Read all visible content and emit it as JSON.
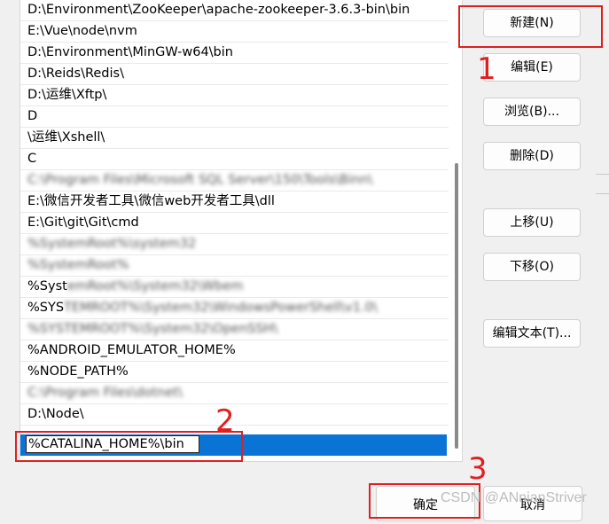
{
  "path_list": {
    "entries": [
      {
        "text": "D:\\Environment\\ZooKeeper\\apache-zookeeper-3.6.3-bin\\bin",
        "blurred": false
      },
      {
        "text": "E:\\Vue\\node\\nvm",
        "blurred": false
      },
      {
        "text": "D:\\Environment\\MinGW-w64\\bin",
        "blurred": false
      },
      {
        "text": "D:\\Reids\\Redis\\",
        "blurred": false
      },
      {
        "text": "D:\\运维\\Xftp\\",
        "blurred": false
      },
      {
        "text": "D",
        "blurred": false
      },
      {
        "text": "\\运维\\Xshell\\",
        "blurred": false
      },
      {
        "text": "C",
        "blurred": false
      },
      {
        "text": "",
        "blurred": true
      },
      {
        "text": "E:\\微信开发者工具\\微信web开发者工具\\dll",
        "blurred": false
      },
      {
        "text": "E:\\Git\\git\\Git\\cmd",
        "blurred": false
      },
      {
        "text": "",
        "blurred": true
      },
      {
        "text": "",
        "blurred": true
      },
      {
        "text": "%Syst",
        "blurred": false
      },
      {
        "text": "%SYS",
        "blurred": false
      },
      {
        "text": "",
        "blurred": true
      },
      {
        "text": "%ANDROID_EMULATOR_HOME%",
        "blurred": false
      },
      {
        "text": "%NODE_PATH%",
        "blurred": false
      },
      {
        "text": "",
        "blurred": true
      },
      {
        "text": "D:\\Node\\",
        "blurred": false
      }
    ],
    "editing_value": "%CATALINA_HOME%\\bin"
  },
  "buttons": {
    "new": "新建(N)",
    "edit": "编辑(E)",
    "browse": "浏览(B)...",
    "delete": "删除(D)",
    "move_up": "上移(U)",
    "move_down": "下移(O)",
    "edit_text": "编辑文本(T)...",
    "ok": "确定",
    "cancel": "取消"
  },
  "annotations": {
    "step1": "1",
    "step2": "2",
    "step3": "3"
  },
  "watermark": "CSDN @ANnianStriver",
  "colors": {
    "selection": "#0a74d6",
    "annotation": "#e02020"
  }
}
